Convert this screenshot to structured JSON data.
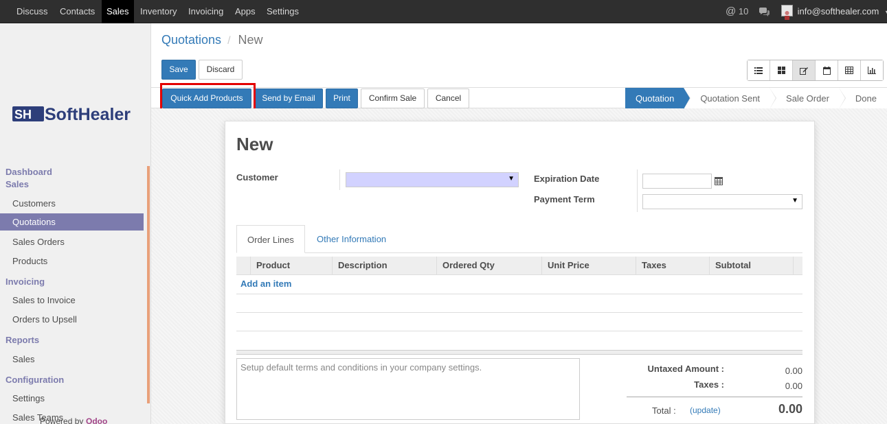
{
  "topbar": {
    "menu": [
      "Discuss",
      "Contacts",
      "Sales",
      "Inventory",
      "Invoicing",
      "Apps",
      "Settings"
    ],
    "active_menu": "Sales",
    "notification_count": "10",
    "user_email": "info@softhealer.com"
  },
  "sidebar": {
    "logo_text": "SoftHealer",
    "sections": {
      "dashboard": "Dashboard",
      "sales": "Sales",
      "invoicing": "Invoicing",
      "reports": "Reports",
      "configuration": "Configuration"
    },
    "items": {
      "customers": "Customers",
      "quotations": "Quotations",
      "sales_orders": "Sales Orders",
      "products": "Products",
      "sales_to_invoice": "Sales to Invoice",
      "orders_to_upsell": "Orders to Upsell",
      "sales": "Sales",
      "settings": "Settings",
      "sales_teams": "Sales Teams"
    },
    "powered_by": "Powered by",
    "powered_brand": "Odoo"
  },
  "control": {
    "breadcrumb_parent": "Quotations",
    "breadcrumb_sep": "/",
    "breadcrumb_current": "New",
    "save": "Save",
    "discard": "Discard"
  },
  "statusbar": {
    "buttons": {
      "quick_add": "Quick Add Products",
      "send_email": "Send by Email",
      "print": "Print",
      "confirm": "Confirm Sale",
      "cancel": "Cancel"
    },
    "stages": [
      "Quotation",
      "Quotation Sent",
      "Sale Order",
      "Done"
    ],
    "active_stage": "Quotation"
  },
  "form": {
    "title": "New",
    "customer_label": "Customer",
    "customer_value": "",
    "expiration_label": "Expiration Date",
    "expiration_value": "",
    "payment_term_label": "Payment Term",
    "payment_term_value": "",
    "tabs": [
      "Order Lines",
      "Other Information"
    ],
    "columns": [
      "Product",
      "Description",
      "Ordered Qty",
      "Unit Price",
      "Taxes",
      "Subtotal"
    ],
    "add_item": "Add an item",
    "terms_placeholder": "Setup default terms and conditions in your company settings.",
    "untaxed_label": "Untaxed Amount :",
    "untaxed_value": "0.00",
    "taxes_label": "Taxes :",
    "taxes_value": "0.00",
    "total_label": "Total :",
    "update_link": "(update)",
    "total_value": "0.00"
  },
  "colors": {
    "primary": "#337ab7",
    "sidebar_accent": "#7c7bad",
    "highlight": "#e30000",
    "required_field": "#d2d2ff"
  }
}
